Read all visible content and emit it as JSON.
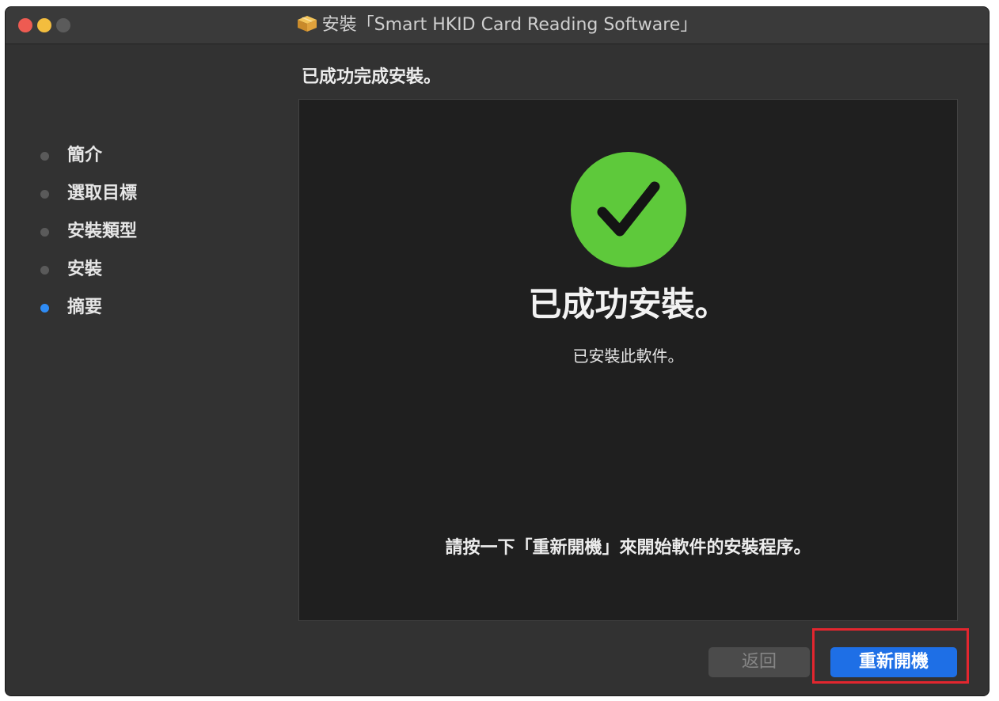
{
  "window": {
    "title": "安裝「Smart HKID Card Reading Software」"
  },
  "sidebar": {
    "steps": [
      {
        "label": "簡介",
        "active": false
      },
      {
        "label": "選取目標",
        "active": false
      },
      {
        "label": "安裝類型",
        "active": false
      },
      {
        "label": "安裝",
        "active": false
      },
      {
        "label": "摘要",
        "active": true
      }
    ]
  },
  "main": {
    "heading": "已成功完成安裝。",
    "status_icon": "checkmark-circle-icon",
    "status_color": "#5ec93b",
    "big_title": "已成功安裝。",
    "subtitle": "已安裝此軟件。",
    "instruction": "請按一下「重新開機」來開始軟件的安裝程序。"
  },
  "buttons": {
    "back_label": "返回",
    "restart_label": "重新開機"
  },
  "colors": {
    "accent": "#1e6fe6",
    "active_dot": "#2f8cf5",
    "highlight_box": "#e3262f"
  }
}
